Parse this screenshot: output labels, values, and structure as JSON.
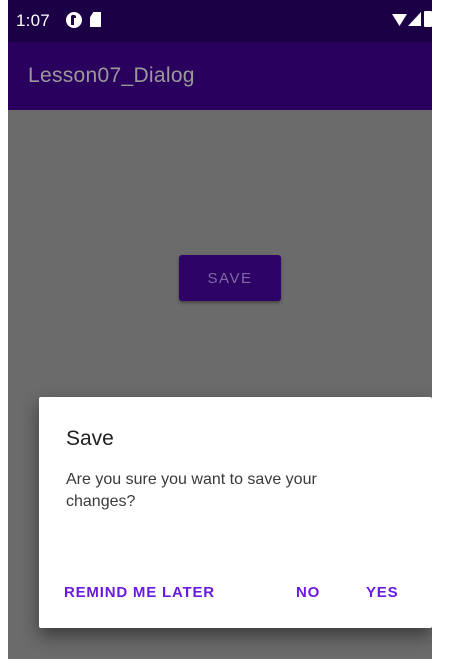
{
  "status_bar": {
    "time": "1:07"
  },
  "app_bar": {
    "title": "Lesson07_Dialog"
  },
  "main": {
    "save_button_label": "SAVE"
  },
  "dialog": {
    "title": "Save",
    "message": "Are you sure you want to save your changes?",
    "buttons": {
      "neutral": "REMIND ME LATER",
      "negative": "NO",
      "positive": "YES"
    }
  },
  "colors": {
    "status_bar": "#1b0045",
    "app_bar": "#2a005e",
    "scrim_background": "#6b6b6b",
    "dialog_button_text": "#6a1be0",
    "primary_button": "#2e0366"
  },
  "icons": [
    "notification-icon",
    "sd-card-icon",
    "wifi-icon",
    "signal-icon",
    "battery-icon"
  ]
}
